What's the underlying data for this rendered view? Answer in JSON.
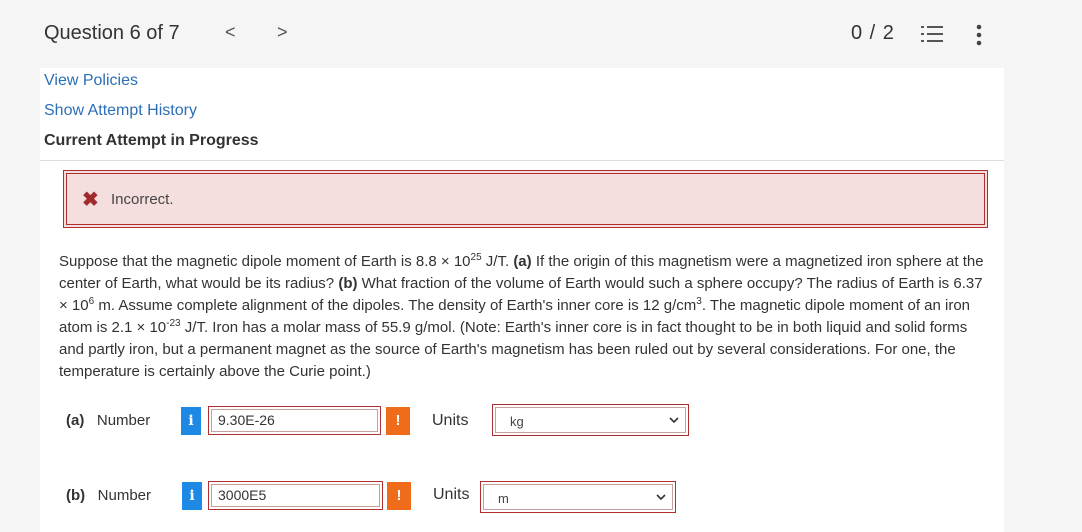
{
  "header": {
    "question_label": "Question 6 of 7",
    "prev_glyph": "<",
    "next_glyph": ">",
    "score": "0 / 2"
  },
  "links": {
    "view_policies": "View Policies",
    "show_attempt_history": "Show Attempt History"
  },
  "status_heading": "Current Attempt in Progress",
  "alert": {
    "icon": "x-icon",
    "text": "Incorrect.",
    "color": "#a12a2a",
    "background": "#f5dede"
  },
  "problem": {
    "seg1": "Suppose that the magnetic dipole moment of Earth is 8.8 × 10",
    "sup1": "25",
    "seg2": " J/T. ",
    "bold_a": "(a)",
    "seg3": " If the origin of this magnetism were a magnetized iron sphere at the center of Earth, what would be its radius? ",
    "bold_b": "(b)",
    "seg4": " What fraction of the volume of Earth would such a sphere occupy? The radius of Earth is 6.37 × 10",
    "sup2": "6",
    "seg5": " m. Assume complete alignment of the dipoles. The density of Earth's inner core is 12 g/cm",
    "sup3": "3",
    "seg6": ". The magnetic dipole moment of an iron atom is 2.1 × 10",
    "sup4": "-23",
    "seg7": " J/T. Iron has a molar mass of 55.9 g/mol. (Note: Earth's inner core is in fact thought to be in both liquid and solid forms and partly iron, but a permanent magnet as the source of Earth's magnetism has been ruled out by several considerations. For one, the temperature is certainly above the Curie point.)"
  },
  "answers": [
    {
      "part": "(a)",
      "label": "Number",
      "info_glyph": "i",
      "value": "9.30E-26",
      "warn_glyph": "!",
      "units_label": "Units",
      "units_value": "kg"
    },
    {
      "part": "(b)",
      "label": "Number",
      "info_glyph": "i",
      "value": "3000E5",
      "warn_glyph": "!",
      "units_label": "Units",
      "units_value": "m"
    }
  ],
  "colors": {
    "link": "#2b6fb6",
    "info": "#1e88e5",
    "warning": "#ef6c1a",
    "error_border": "#b03030"
  }
}
